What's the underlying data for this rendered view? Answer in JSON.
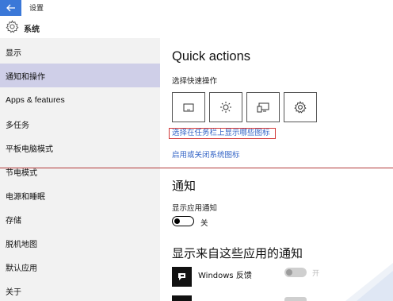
{
  "window": {
    "title": "设置",
    "back_icon": "back-arrow-icon",
    "back_color": "#3b78d8"
  },
  "sidebar": {
    "header": {
      "icon": "gear-icon",
      "label": "系统"
    },
    "items": [
      {
        "label": "显示"
      },
      {
        "label": "通知和操作",
        "selected": true
      },
      {
        "label": "Apps & features"
      },
      {
        "label": "多任务"
      },
      {
        "label": "平板电脑模式"
      },
      {
        "label": "节电模式"
      },
      {
        "label": "电源和睡眠"
      },
      {
        "label": "存储"
      },
      {
        "label": "脱机地图"
      },
      {
        "label": "默认应用"
      },
      {
        "label": "关于"
      }
    ]
  },
  "main": {
    "quick_actions": {
      "title": "Quick actions",
      "subtitle": "选择快速操作",
      "buttons": [
        {
          "icon": "tablet-mode-icon"
        },
        {
          "icon": "brightness-icon"
        },
        {
          "icon": "connect-display-icon"
        },
        {
          "icon": "settings-gear-icon"
        }
      ],
      "link_taskbar": "选择在任务栏上显示哪些图标",
      "link_system_icons": "启用或关闭系统图标"
    },
    "notifications": {
      "title": "通知",
      "app_notif_label": "显示应用通知",
      "toggle_state": "关"
    },
    "from_apps": {
      "title": "显示来自这些应用的通知",
      "apps": [
        {
          "name": "Windows 反馈",
          "toggle_state": "开",
          "icon": "feedback-app-icon"
        }
      ]
    }
  },
  "colors": {
    "link": "#3565c6",
    "selected_nav": "#cfcfe8",
    "highlight_border": "#d23b3b"
  }
}
